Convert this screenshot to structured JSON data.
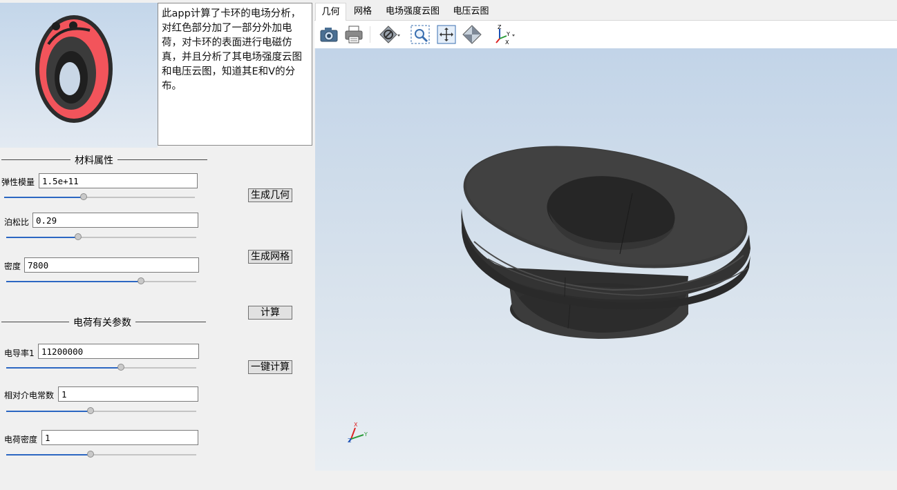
{
  "description": "此app计算了卡环的电场分析，对红色部分加了一部分外加电荷，对卡环的表面进行电磁仿真，并且分析了其电场强度云图和电压云图，知道其E和V的分布。",
  "sections": {
    "material": "材料属性",
    "charge": "电荷有关参数"
  },
  "params": [
    {
      "label": "弹性模量",
      "value": "1.5e+11",
      "slider": 0.42
    },
    {
      "label": "泊松比",
      "value": "0.29",
      "slider": 0.38
    },
    {
      "label": "密度",
      "value": "7800",
      "slider": 0.71
    },
    {
      "label": "电导率1",
      "value": "11200000",
      "slider": 0.6
    },
    {
      "label": "相对介电常数",
      "value": "1",
      "slider": 0.44
    },
    {
      "label": "电荷密度",
      "value": "1",
      "slider": 0.45
    }
  ],
  "buttons": {
    "geometry": "生成几何",
    "mesh": "生成网格",
    "compute": "计算",
    "one_click": "一键计算"
  },
  "tabs": [
    "几何",
    "网格",
    "电场强度云图",
    "电压云图"
  ],
  "active_tab": 0,
  "toolbar": [
    "camera-icon",
    "print-icon",
    "hide-icon",
    "zoom-box-icon",
    "zoom-extents-icon",
    "reset-view-icon",
    "axis-orientation-icon"
  ],
  "axis_triad": {
    "x": "X",
    "y": "Y",
    "z": "Z"
  },
  "colors": {
    "accent": "#2b66c2",
    "highlight": "#f2545b",
    "part": "#3a3a3a"
  }
}
